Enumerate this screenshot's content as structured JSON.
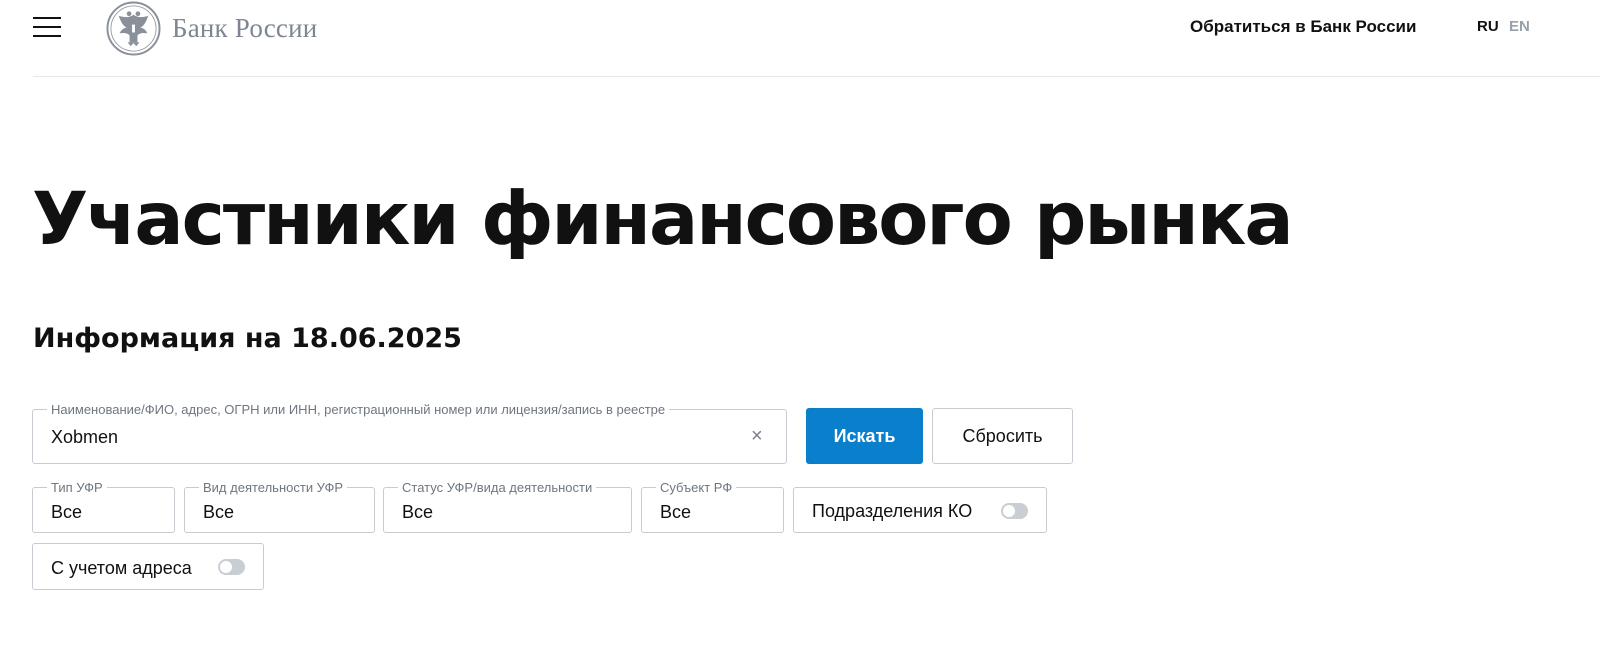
{
  "header": {
    "logo_text": "Банк России",
    "contact_link": "Обратиться в Банк России",
    "languages": [
      {
        "code": "RU",
        "active": true
      },
      {
        "code": "EN",
        "active": false
      }
    ]
  },
  "main": {
    "title": "Участники финансового рынка",
    "info_date": "Информация на 18.06.2025"
  },
  "search": {
    "label": "Наименование/ФИО, адрес, ОГРН или ИНН, регистрационный номер или лицензия/запись в реестре",
    "value": "Xobmen",
    "clear_icon": "×",
    "search_button": "Искать",
    "reset_button": "Сбросить"
  },
  "filters": [
    {
      "label": "Тип УФР",
      "value": "Все"
    },
    {
      "label": "Вид деятельности УФР",
      "value": "Все"
    },
    {
      "label": "Статус УФР/вида деятельности",
      "value": "Все"
    },
    {
      "label": "Субъект РФ",
      "value": "Все"
    }
  ],
  "toggles": [
    {
      "label": "Подразделения КО",
      "checked": false
    },
    {
      "label": "С учетом адреса",
      "checked": false
    }
  ],
  "colors": {
    "accent": "#0a7fcc",
    "text": "#111111",
    "muted": "#7e8691",
    "border": "#c7ccd2"
  }
}
